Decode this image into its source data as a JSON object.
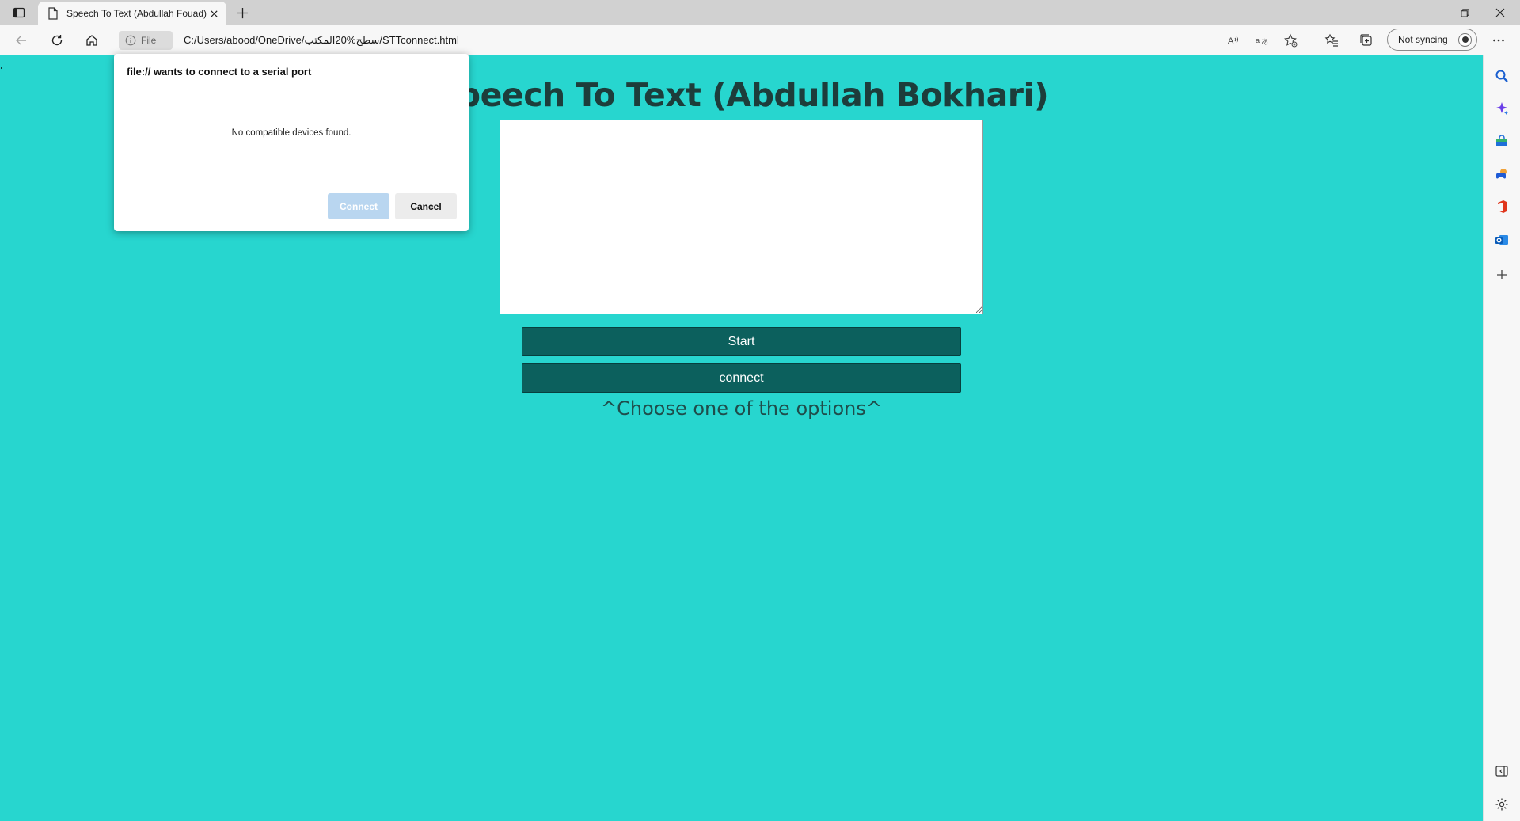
{
  "browser": {
    "tab": {
      "title": "Speech To Text (Abdullah Fouad)"
    },
    "address": {
      "site_info_label": "File",
      "url": "C:/Users/abood/OneDrive/سطح%20المكتب/STTconnect.html"
    },
    "profile": {
      "sync_label": "Not syncing"
    },
    "sidebar": {
      "items": [
        "search-icon",
        "copilot-icon",
        "shopping-icon",
        "games-icon",
        "office-icon",
        "outlook-icon",
        "add-icon"
      ],
      "bottom_items": [
        "hide-sidebar-icon",
        "settings-icon"
      ]
    }
  },
  "page": {
    "title": "Speech To Text (Abdullah Bokhari)",
    "transcript_value": "",
    "start_label": "Start",
    "connect_label": "connect",
    "hint": "^Choose one of the options^",
    "colors": {
      "background": "#27d6cf",
      "button": "#0c605d",
      "title": "#1d3d3b"
    }
  },
  "dialog": {
    "title": "file:// wants to connect to a serial port",
    "message": "No compatible devices found.",
    "connect_label": "Connect",
    "cancel_label": "Cancel"
  }
}
